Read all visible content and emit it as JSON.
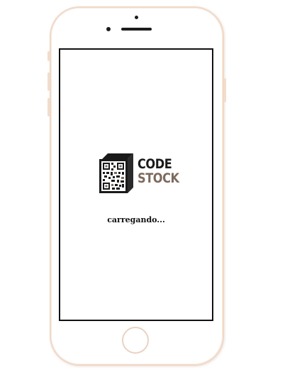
{
  "app": {
    "logo_line1": "CODE",
    "logo_line2": "STOCK",
    "loading_label": "carregando..."
  },
  "colors": {
    "frame": "#f0d9c8",
    "logo_dark": "#1a1a1a",
    "logo_accent": "#7d6a5d"
  },
  "icons": {
    "logo_mark": "qr-code-box-icon"
  }
}
